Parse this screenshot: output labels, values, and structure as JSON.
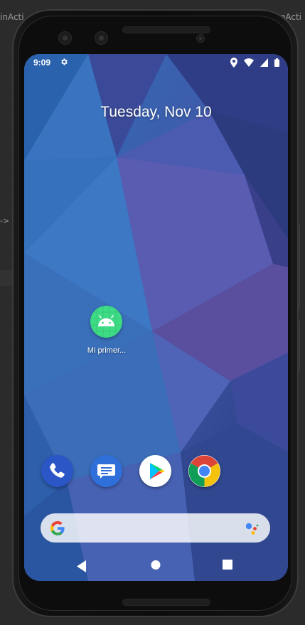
{
  "ide": {
    "left_fragment": "inActi",
    "right_fragment": "eActi",
    "arrow_fragment": "->"
  },
  "status_bar": {
    "time": "9:09",
    "icons": [
      "settings-icon",
      "location-icon",
      "wifi-icon",
      "cellular-signal-icon",
      "battery-icon"
    ]
  },
  "home": {
    "date": "Tuesday, Nov 10",
    "apps": [
      {
        "label": "Mi primer...",
        "icon": "android-icon"
      }
    ],
    "dock": [
      {
        "app": "Phone",
        "icon": "phone-icon"
      },
      {
        "app": "Messages",
        "icon": "messages-icon"
      },
      {
        "app": "Play Store",
        "icon": "play-store-icon"
      },
      {
        "app": "Chrome",
        "icon": "chrome-icon"
      }
    ],
    "search": {
      "icons": [
        "google-g-icon",
        "google-assistant-icon"
      ]
    }
  },
  "nav": {
    "icons": [
      "back-icon",
      "home-icon",
      "recents-icon"
    ]
  },
  "colors": {
    "wallpaper_base": "#2f4f9a",
    "android_green": "#3ddc84",
    "phone_blue": "#2a56c6",
    "messages_blue": "#2f6fda",
    "ide_background": "#2b2b2b"
  }
}
